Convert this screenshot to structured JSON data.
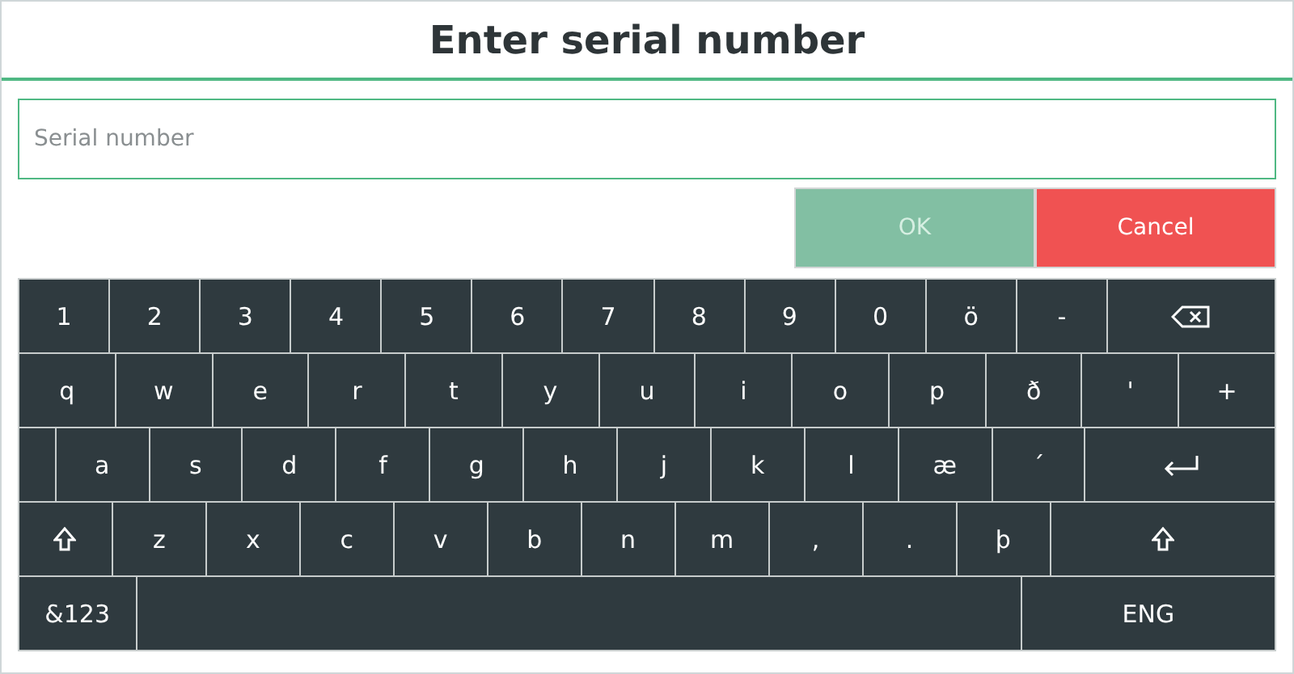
{
  "dialog": {
    "title": "Enter serial number"
  },
  "serial_field": {
    "placeholder": "Serial number"
  },
  "buttons": [
    {
      "label": "OK",
      "kind": "ok",
      "disabled": true
    },
    {
      "label": "Cancel",
      "kind": "cancel",
      "disabled": false
    }
  ],
  "keyboard": {
    "rows": [
      [
        {
          "kind": "char",
          "label": "1"
        },
        {
          "kind": "char",
          "label": "2"
        },
        {
          "kind": "char",
          "label": "3"
        },
        {
          "kind": "char",
          "label": "4"
        },
        {
          "kind": "char",
          "label": "5"
        },
        {
          "kind": "char",
          "label": "6"
        },
        {
          "kind": "char",
          "label": "7"
        },
        {
          "kind": "char",
          "label": "8"
        },
        {
          "kind": "char",
          "label": "9"
        },
        {
          "kind": "char",
          "label": "0"
        },
        {
          "kind": "char",
          "label": "ö"
        },
        {
          "kind": "char",
          "label": "-"
        },
        {
          "kind": "backspace"
        }
      ],
      [
        {
          "kind": "char",
          "label": "q"
        },
        {
          "kind": "char",
          "label": "w"
        },
        {
          "kind": "char",
          "label": "e"
        },
        {
          "kind": "char",
          "label": "r"
        },
        {
          "kind": "char",
          "label": "t"
        },
        {
          "kind": "char",
          "label": "y"
        },
        {
          "kind": "char",
          "label": "u"
        },
        {
          "kind": "char",
          "label": "i"
        },
        {
          "kind": "char",
          "label": "o"
        },
        {
          "kind": "char",
          "label": "p"
        },
        {
          "kind": "char",
          "label": "ð"
        },
        {
          "kind": "char",
          "label": "'"
        },
        {
          "kind": "char",
          "label": "+"
        }
      ],
      [
        {
          "kind": "blank"
        },
        {
          "kind": "char",
          "label": "a"
        },
        {
          "kind": "char",
          "label": "s"
        },
        {
          "kind": "char",
          "label": "d"
        },
        {
          "kind": "char",
          "label": "f"
        },
        {
          "kind": "char",
          "label": "g"
        },
        {
          "kind": "char",
          "label": "h"
        },
        {
          "kind": "char",
          "label": "j"
        },
        {
          "kind": "char",
          "label": "k"
        },
        {
          "kind": "char",
          "label": "l"
        },
        {
          "kind": "char",
          "label": "æ"
        },
        {
          "kind": "char",
          "label": "´"
        },
        {
          "kind": "enter"
        }
      ],
      [
        {
          "kind": "shift"
        },
        {
          "kind": "char",
          "label": "z"
        },
        {
          "kind": "char",
          "label": "x"
        },
        {
          "kind": "char",
          "label": "c"
        },
        {
          "kind": "char",
          "label": "v"
        },
        {
          "kind": "char",
          "label": "b"
        },
        {
          "kind": "char",
          "label": "n"
        },
        {
          "kind": "char",
          "label": "m"
        },
        {
          "kind": "char",
          "label": ","
        },
        {
          "kind": "char",
          "label": "."
        },
        {
          "kind": "char",
          "label": "þ"
        },
        {
          "kind": "shift_wide"
        }
      ],
      [
        {
          "kind": "symbols",
          "label": "&123"
        },
        {
          "kind": "space"
        },
        {
          "kind": "language",
          "label": "ENG"
        }
      ]
    ]
  }
}
